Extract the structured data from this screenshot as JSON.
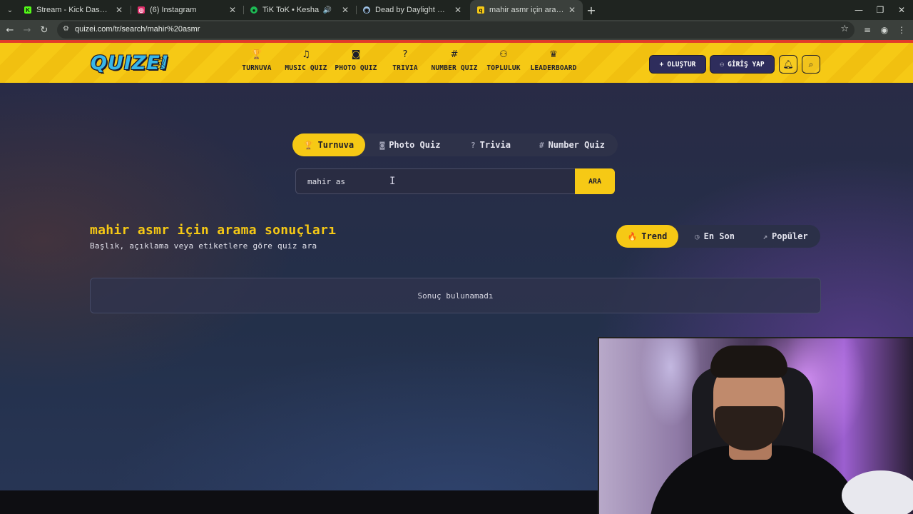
{
  "browser": {
    "tabs": [
      {
        "title": "Stream - Kick Dashboard",
        "favicon": "kick-icon",
        "color": "#53fc18",
        "glyph": "K"
      },
      {
        "title": "(6) Instagram",
        "favicon": "instagram-icon",
        "color": "#e1306c",
        "glyph": "◎"
      },
      {
        "title": "TiK ToK • Kesha",
        "favicon": "spotify-icon",
        "color": "#1db954",
        "glyph": "●"
      },
      {
        "title": "Dead by Daylight Steam'de",
        "favicon": "steam-icon",
        "color": "#9ec3e6",
        "glyph": "◉"
      },
      {
        "title": "mahir asmr için arama sonuçları",
        "favicon": "quizei-icon",
        "color": "#f6c915",
        "glyph": "q"
      }
    ],
    "url": "quizei.com/tr/search/mahir%20asmr"
  },
  "site": {
    "logo": "QUIZEI",
    "nav": [
      {
        "label": "TURNUVA",
        "icon": "🏆"
      },
      {
        "label": "MUSIC QUIZ",
        "icon": "♫"
      },
      {
        "label": "PHOTO QUIZ",
        "icon": "◙"
      },
      {
        "label": "TRIVIA",
        "icon": "?"
      },
      {
        "label": "NUMBER QUIZ",
        "icon": "#"
      },
      {
        "label": "TOPLULUK",
        "icon": "⚇"
      },
      {
        "label": "LEADERBOARD",
        "icon": "♛"
      }
    ],
    "create_label": "OLUŞTUR",
    "login_label": "GİRİŞ YAP",
    "accent": "#f6c915",
    "dark_button": "#2e2d5c"
  },
  "categories": [
    {
      "label": "Turnuva",
      "icon": "🏆",
      "active": true
    },
    {
      "label": "Photo Quiz",
      "icon": "◙",
      "active": false
    },
    {
      "label": "Trivia",
      "icon": "?",
      "active": false
    },
    {
      "label": "Number Quiz",
      "icon": "#",
      "active": false
    }
  ],
  "search": {
    "value": "mahir as",
    "button_label": "ARA"
  },
  "results": {
    "title": "mahir asmr için arama sonuçları",
    "subtitle": "Başlık, açıklama veya etiketlere göre quiz ara",
    "empty_text": "Sonuç bulunamadı"
  },
  "sort": [
    {
      "label": "Trend",
      "icon": "🔥",
      "active": true
    },
    {
      "label": "En Son",
      "icon": "◷",
      "active": false
    },
    {
      "label": "Popüler",
      "icon": "↗",
      "active": false
    }
  ]
}
